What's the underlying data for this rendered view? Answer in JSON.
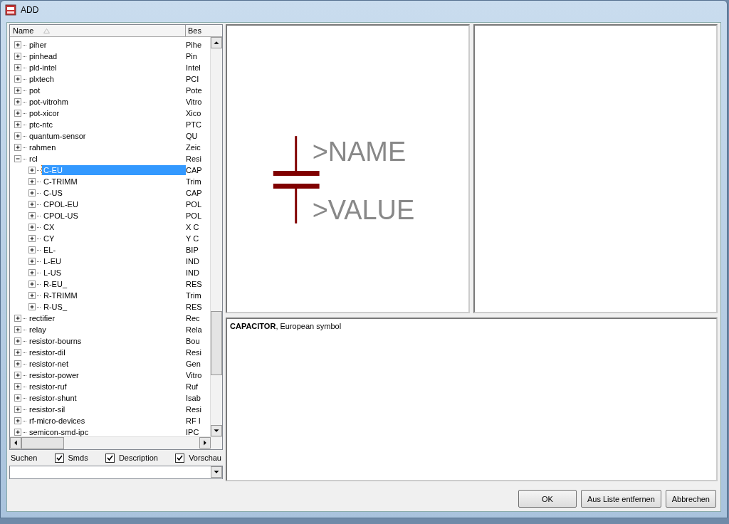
{
  "window": {
    "title": "ADD"
  },
  "tree": {
    "columns": [
      "Name",
      "Bes"
    ],
    "items": [
      {
        "name": "piher",
        "desc": "Pihe",
        "expanded": false,
        "selected": false
      },
      {
        "name": "pinhead",
        "desc": "Pin",
        "expanded": false,
        "selected": false
      },
      {
        "name": "pld-intel",
        "desc": "Intel",
        "expanded": false,
        "selected": false
      },
      {
        "name": "plxtech",
        "desc": "PCI",
        "expanded": false,
        "selected": false
      },
      {
        "name": "pot",
        "desc": "Pote",
        "expanded": false,
        "selected": false
      },
      {
        "name": "pot-vitrohm",
        "desc": "Vitro",
        "expanded": false,
        "selected": false
      },
      {
        "name": "pot-xicor",
        "desc": "Xico",
        "expanded": false,
        "selected": false
      },
      {
        "name": "ptc-ntc",
        "desc": "PTC",
        "expanded": false,
        "selected": false
      },
      {
        "name": "quantum-sensor",
        "desc": "QU",
        "expanded": false,
        "selected": false
      },
      {
        "name": "rahmen",
        "desc": "Zeic",
        "expanded": false,
        "selected": false
      },
      {
        "name": "rcl",
        "desc": "Resi",
        "expanded": true,
        "selected": false,
        "children": [
          {
            "name": "C-EU",
            "desc": "CAP",
            "expanded": false,
            "selected": true
          },
          {
            "name": "C-TRIMM",
            "desc": "Trim",
            "expanded": false,
            "selected": false
          },
          {
            "name": "C-US",
            "desc": "CAP",
            "expanded": false,
            "selected": false
          },
          {
            "name": "CPOL-EU",
            "desc": "POL",
            "expanded": false,
            "selected": false
          },
          {
            "name": "CPOL-US",
            "desc": "POL",
            "expanded": false,
            "selected": false
          },
          {
            "name": "CX",
            "desc": "X C",
            "expanded": false,
            "selected": false
          },
          {
            "name": "CY",
            "desc": "Y C",
            "expanded": false,
            "selected": false
          },
          {
            "name": "EL-",
            "desc": "BIP",
            "expanded": false,
            "selected": false
          },
          {
            "name": "L-EU",
            "desc": "IND",
            "expanded": false,
            "selected": false
          },
          {
            "name": "L-US",
            "desc": "IND",
            "expanded": false,
            "selected": false
          },
          {
            "name": "R-EU_",
            "desc": "RES",
            "expanded": false,
            "selected": false
          },
          {
            "name": "R-TRIMM",
            "desc": "Trim",
            "expanded": false,
            "selected": false
          },
          {
            "name": "R-US_",
            "desc": "RES",
            "expanded": false,
            "selected": false
          }
        ]
      },
      {
        "name": "rectifier",
        "desc": "Rec",
        "expanded": false,
        "selected": false
      },
      {
        "name": "relay",
        "desc": "Rela",
        "expanded": false,
        "selected": false
      },
      {
        "name": "resistor-bourns",
        "desc": "Bou",
        "expanded": false,
        "selected": false
      },
      {
        "name": "resistor-dil",
        "desc": "Resi",
        "expanded": false,
        "selected": false
      },
      {
        "name": "resistor-net",
        "desc": "Gen",
        "expanded": false,
        "selected": false
      },
      {
        "name": "resistor-power",
        "desc": "Vitro",
        "expanded": false,
        "selected": false
      },
      {
        "name": "resistor-ruf",
        "desc": "Ruf",
        "expanded": false,
        "selected": false
      },
      {
        "name": "resistor-shunt",
        "desc": "Isab",
        "expanded": false,
        "selected": false
      },
      {
        "name": "resistor-sil",
        "desc": "Resi",
        "expanded": false,
        "selected": false
      },
      {
        "name": "rf-micro-devices",
        "desc": "RF I",
        "expanded": false,
        "selected": false
      },
      {
        "name": "semicon-smd-ipc",
        "desc": "IPC",
        "expanded": false,
        "selected": false
      }
    ]
  },
  "options": {
    "search_label": "Suchen",
    "checkboxes": [
      {
        "label": "Smds",
        "checked": true
      },
      {
        "label": "Description",
        "checked": true
      },
      {
        "label": "Vorschau",
        "checked": true
      }
    ]
  },
  "preview": {
    "name_label": ">NAME",
    "value_label": ">VALUE"
  },
  "description": "**CAPACITOR**, European symbol",
  "buttons": [
    "OK",
    "Aus Liste entfernen",
    "Abbrechen"
  ]
}
